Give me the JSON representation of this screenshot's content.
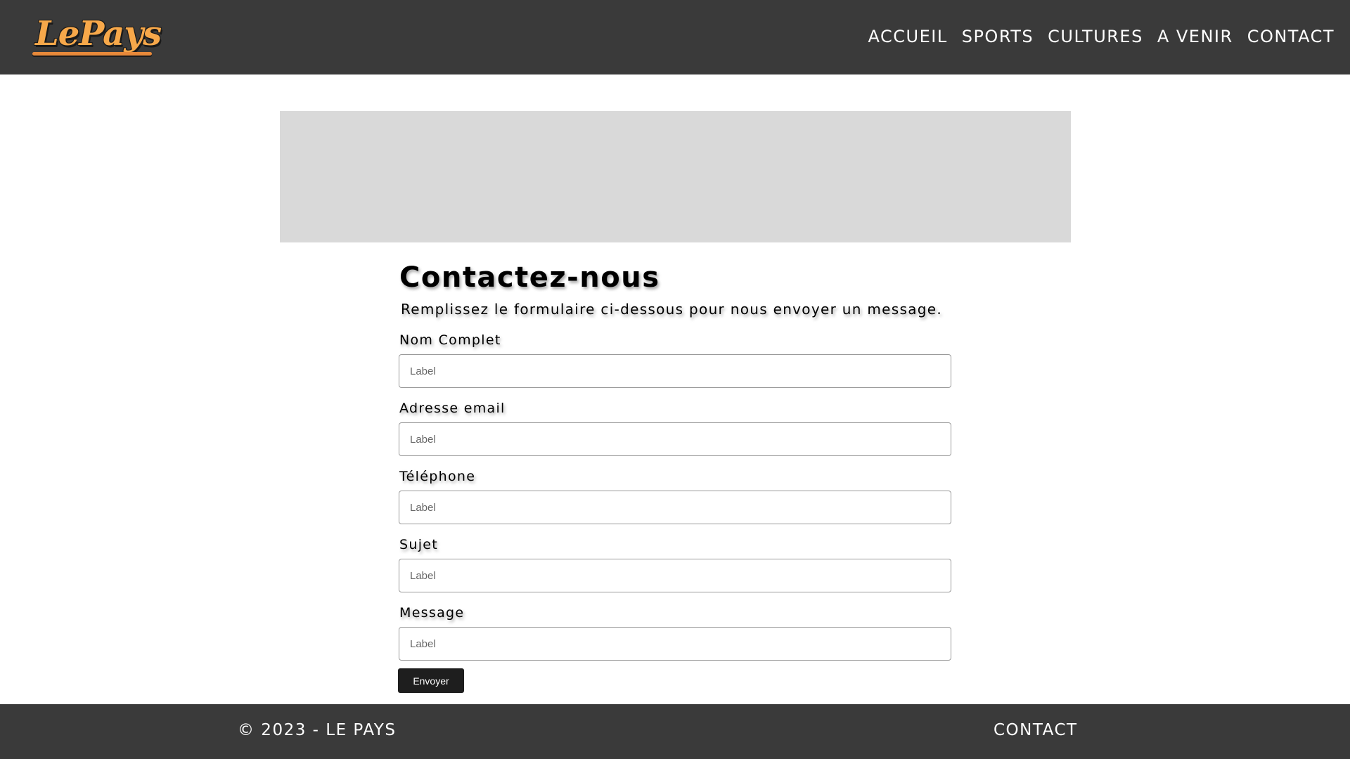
{
  "header": {
    "logo_text": "LePays",
    "nav": [
      {
        "label": "ACCUEIL"
      },
      {
        "label": "SPORTS"
      },
      {
        "label": "CULTURES"
      },
      {
        "label": "A VENIR"
      },
      {
        "label": "CONTACT"
      }
    ]
  },
  "main": {
    "title": "Contactez-nous",
    "subtitle": "Remplissez le formulaire ci-dessous pour nous envoyer un message.",
    "fields": [
      {
        "label": "Nom Complet",
        "placeholder": "Label"
      },
      {
        "label": "Adresse email",
        "placeholder": "Label"
      },
      {
        "label": "Téléphone",
        "placeholder": "Label"
      },
      {
        "label": "Sujet",
        "placeholder": "Label"
      },
      {
        "label": "Message",
        "placeholder": "Label"
      }
    ],
    "submit_label": "Envoyer"
  },
  "footer": {
    "copyright": "© 2023 - LE PAYS",
    "contact_label": "CONTACT"
  },
  "colors": {
    "header_bg": "#3a3a3a",
    "footer_bg": "#3a3a3a",
    "banner_bg": "#d9d9d9",
    "logo_accent": "#f7a84a",
    "button_bg": "#1e1e1e"
  }
}
